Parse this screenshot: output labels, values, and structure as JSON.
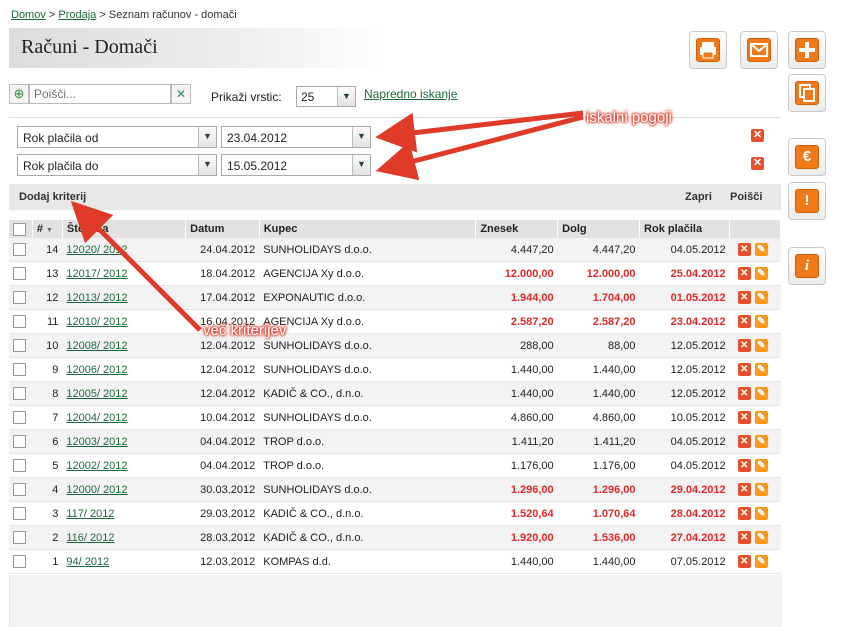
{
  "breadcrumb": {
    "home": "Domov",
    "section": "Prodaja",
    "current": "Seznam računov - domači"
  },
  "page_title": "Računi - Domači",
  "search": {
    "placeholder": "Poišči...",
    "rows_label": "Prikaži vrstic:",
    "rows_value": "25",
    "advanced_link": "Napredno iskanje"
  },
  "criteria": [
    {
      "field": "Rok plačila od",
      "value": "23.04.2012"
    },
    {
      "field": "Rok plačila do",
      "value": "15.05.2012"
    }
  ],
  "criteria_bar": {
    "add": "Dodaj kriterij",
    "close": "Zapri",
    "search": "Poišči"
  },
  "table": {
    "headers": {
      "num": "#",
      "number": "Številka",
      "date": "Datum",
      "customer": "Kupec",
      "amount": "Znesek",
      "debt": "Dolg",
      "due": "Rok plačila"
    },
    "rows": [
      {
        "n": "14",
        "number": "12020/ 2012",
        "date": "24.04.2012",
        "customer": "SUNHOLIDAYS d.o.o.",
        "amount": "4.447,20",
        "debt": "4.447,20",
        "due": "04.05.2012",
        "overdue": false
      },
      {
        "n": "13",
        "number": "12017/ 2012",
        "date": "18.04.2012",
        "customer": "AGENCIJA Xy d.o.o.",
        "amount": "12.000,00",
        "debt": "12.000,00",
        "due": "25.04.2012",
        "overdue": true
      },
      {
        "n": "12",
        "number": "12013/ 2012",
        "date": "17.04.2012",
        "customer": "EXPONAUTIC d.o.o.",
        "amount": "1.944,00",
        "debt": "1.704,00",
        "due": "01.05.2012",
        "overdue": true
      },
      {
        "n": "11",
        "number": "12010/ 2012",
        "date": "16.04.2012",
        "customer": "AGENCIJA Xy d.o.o.",
        "amount": "2.587,20",
        "debt": "2.587,20",
        "due": "23.04.2012",
        "overdue": true
      },
      {
        "n": "10",
        "number": "12008/ 2012",
        "date": "12.04.2012",
        "customer": "SUNHOLIDAYS d.o.o.",
        "amount": "288,00",
        "debt": "88,00",
        "due": "12.05.2012",
        "overdue": false
      },
      {
        "n": "9",
        "number": "12006/ 2012",
        "date": "12.04.2012",
        "customer": "SUNHOLIDAYS d.o.o.",
        "amount": "1.440,00",
        "debt": "1.440,00",
        "due": "12.05.2012",
        "overdue": false
      },
      {
        "n": "8",
        "number": "12005/ 2012",
        "date": "12.04.2012",
        "customer": "KADIČ & CO., d.n.o.",
        "amount": "1.440,00",
        "debt": "1.440,00",
        "due": "12.05.2012",
        "overdue": false
      },
      {
        "n": "7",
        "number": "12004/ 2012",
        "date": "10.04.2012",
        "customer": "SUNHOLIDAYS d.o.o.",
        "amount": "4.860,00",
        "debt": "4.860,00",
        "due": "10.05.2012",
        "overdue": false
      },
      {
        "n": "6",
        "number": "12003/ 2012",
        "date": "04.04.2012",
        "customer": "TROP d.o.o.",
        "amount": "1.411,20",
        "debt": "1.411,20",
        "due": "04.05.2012",
        "overdue": false
      },
      {
        "n": "5",
        "number": "12002/ 2012",
        "date": "04.04.2012",
        "customer": "TROP d.o.o.",
        "amount": "1.176,00",
        "debt": "1.176,00",
        "due": "04.05.2012",
        "overdue": false
      },
      {
        "n": "4",
        "number": "12000/ 2012",
        "date": "30.03.2012",
        "customer": "SUNHOLIDAYS d.o.o.",
        "amount": "1.296,00",
        "debt": "1.296,00",
        "due": "29.04.2012",
        "overdue": true
      },
      {
        "n": "3",
        "number": "117/ 2012",
        "date": "29.03.2012",
        "customer": "KADIČ & CO., d.n.o.",
        "amount": "1.520,64",
        "debt": "1.070,64",
        "due": "28.04.2012",
        "overdue": true
      },
      {
        "n": "2",
        "number": "116/ 2012",
        "date": "28.03.2012",
        "customer": "KADIČ & CO., d.n.o.",
        "amount": "1.920,00",
        "debt": "1.536,00",
        "due": "27.04.2012",
        "overdue": true
      },
      {
        "n": "1",
        "number": "94/ 2012",
        "date": "12.03.2012",
        "customer": "KOMPAS d.d.",
        "amount": "1.440,00",
        "debt": "1.440,00",
        "due": "07.05.2012",
        "overdue": false
      }
    ]
  },
  "annotations": {
    "search_conditions": "iskalni pogoji",
    "more_criteria": "več kriterijev"
  },
  "colors": {
    "accent": "#f07a1a",
    "overdue": "#e22a2a",
    "link": "#1d6b3a",
    "annotation": "#e03a28"
  }
}
